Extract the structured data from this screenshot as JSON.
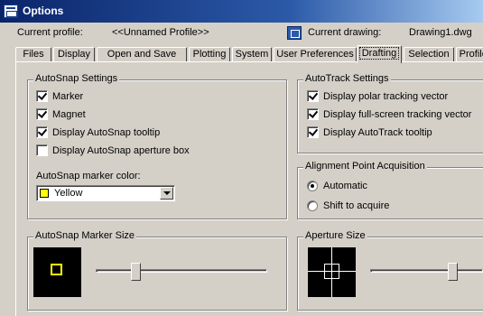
{
  "window": {
    "title": "Options"
  },
  "profile_row": {
    "current_profile_label": "Current profile:",
    "current_profile_value": "<<Unnamed Profile>>",
    "current_drawing_label": "Current drawing:",
    "current_drawing_value": "Drawing1.dwg"
  },
  "tabs": [
    {
      "label": "Files"
    },
    {
      "label": "Display"
    },
    {
      "label": "Open and Save"
    },
    {
      "label": "Plotting"
    },
    {
      "label": "System"
    },
    {
      "label": "User Preferences"
    },
    {
      "label": "Drafting"
    },
    {
      "label": "Selection"
    },
    {
      "label": "Profiles"
    }
  ],
  "autosnap": {
    "legend": "AutoSnap Settings",
    "options": [
      {
        "label": "Marker",
        "checked": true
      },
      {
        "label": "Magnet",
        "checked": true
      },
      {
        "label": "Display AutoSnap tooltip",
        "checked": true
      },
      {
        "label": "Display AutoSnap aperture box",
        "checked": false
      }
    ],
    "marker_color_label": "AutoSnap marker color:",
    "marker_color_value": "Yellow",
    "marker_color_hex": "#ffff00"
  },
  "autotrack": {
    "legend": "AutoTrack Settings",
    "options": [
      {
        "label": "Display polar tracking vector",
        "checked": true
      },
      {
        "label": "Display full-screen tracking vector",
        "checked": true
      },
      {
        "label": "Display AutoTrack tooltip",
        "checked": true
      }
    ]
  },
  "alignment": {
    "legend": "Alignment Point Acquisition",
    "options": [
      {
        "label": "Automatic",
        "selected": true
      },
      {
        "label": "Shift to acquire",
        "selected": false
      }
    ]
  },
  "marker_size": {
    "legend": "AutoSnap Marker Size",
    "slider_fraction": 0.22
  },
  "aperture_size": {
    "legend": "Aperture Size",
    "slider_fraction": 0.75
  }
}
